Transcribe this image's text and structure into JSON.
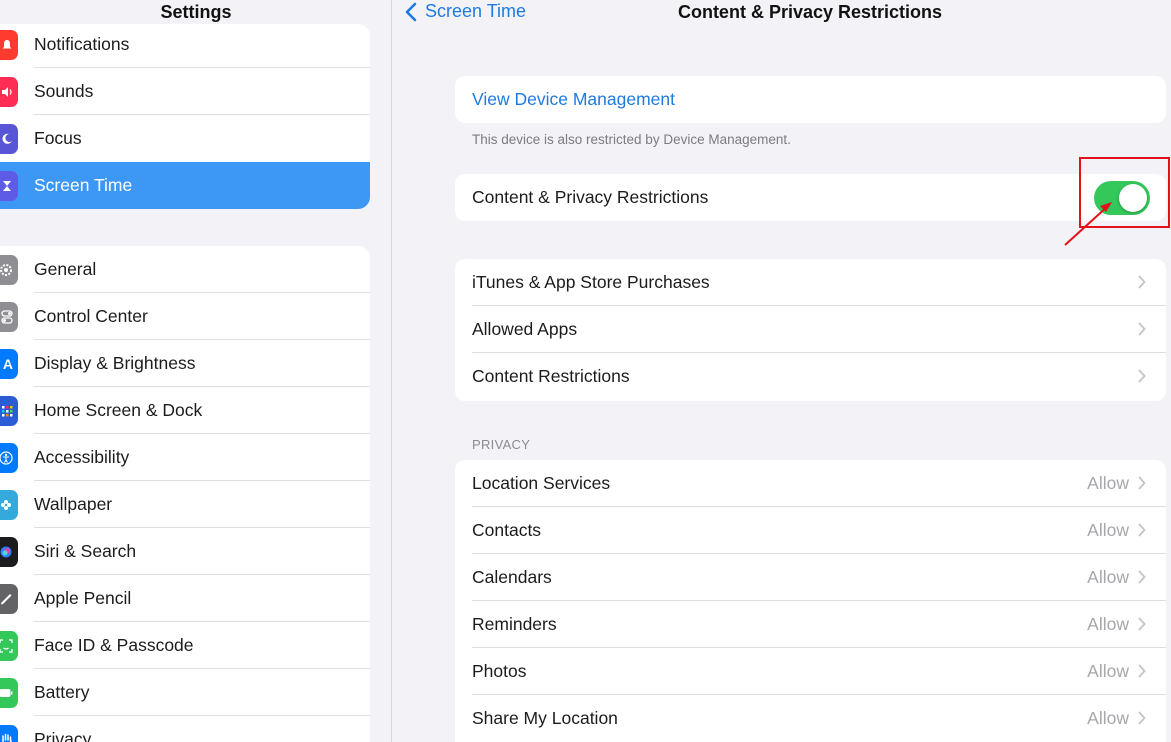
{
  "sidebar": {
    "title": "Settings",
    "group1": [
      {
        "label": "Notifications",
        "icon": "bell-icon",
        "color": "#ff3b30"
      },
      {
        "label": "Sounds",
        "icon": "speaker-icon",
        "color": "#ff2d55"
      },
      {
        "label": "Focus",
        "icon": "moon-icon",
        "color": "#5856d6"
      },
      {
        "label": "Screen Time",
        "icon": "hourglass-icon",
        "color": "#5e5ce6",
        "selected": true
      }
    ],
    "group2": [
      {
        "label": "General",
        "icon": "gear-icon",
        "color": "#8e8e93"
      },
      {
        "label": "Control Center",
        "icon": "toggles-icon",
        "color": "#8e8e93"
      },
      {
        "label": "Display & Brightness",
        "icon": "display-icon",
        "color": "#007aff"
      },
      {
        "label": "Home Screen & Dock",
        "icon": "grid-icon",
        "color": "#2c5bd6"
      },
      {
        "label": "Accessibility",
        "icon": "accessibility-icon",
        "color": "#007aff"
      },
      {
        "label": "Wallpaper",
        "icon": "flower-icon",
        "color": "#34aadc"
      },
      {
        "label": "Siri & Search",
        "icon": "siri-icon",
        "color": "#1c1c1e"
      },
      {
        "label": "Apple Pencil",
        "icon": "pencil-icon",
        "color": "#636366"
      },
      {
        "label": "Face ID & Passcode",
        "icon": "faceid-icon",
        "color": "#34c759"
      },
      {
        "label": "Battery",
        "icon": "battery-icon",
        "color": "#34c759"
      },
      {
        "label": "Privacy",
        "icon": "hand-icon",
        "color": "#007aff"
      }
    ]
  },
  "nav": {
    "back_label": "Screen Time",
    "title": "Content & Privacy Restrictions"
  },
  "main": {
    "device_management_link": "View Device Management",
    "device_management_note": "This device is also restricted by Device Management.",
    "restrictions_label": "Content & Privacy Restrictions",
    "restrictions_enabled": true,
    "store_rows": [
      "iTunes & App Store Purchases",
      "Allowed Apps",
      "Content Restrictions"
    ],
    "privacy_header": "PRIVACY",
    "privacy_rows": [
      {
        "label": "Location Services",
        "value": "Allow"
      },
      {
        "label": "Contacts",
        "value": "Allow"
      },
      {
        "label": "Calendars",
        "value": "Allow"
      },
      {
        "label": "Reminders",
        "value": "Allow"
      },
      {
        "label": "Photos",
        "value": "Allow"
      },
      {
        "label": "Share My Location",
        "value": "Allow"
      }
    ]
  },
  "colors": {
    "accent": "#1f7ae0",
    "selected_row": "#3d97f5",
    "toggle_on": "#34c759",
    "annotation": "#e5121b"
  }
}
